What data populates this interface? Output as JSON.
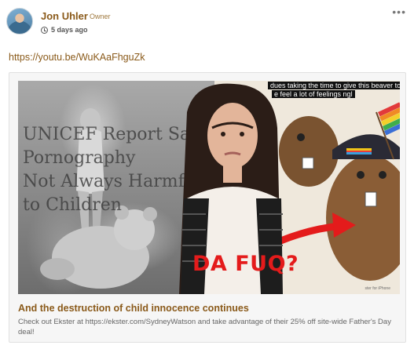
{
  "post": {
    "author": "Jon Uhler",
    "role": "Owner",
    "time": "5 days ago",
    "link_text": "https://youtu.be/WuKAaFhguZk",
    "more_label": "•••"
  },
  "preview": {
    "thumbnail": {
      "overlay_title_lines": [
        "UNICEF Report Says",
        "Pornography",
        "Not Always Harmful",
        "to Children"
      ],
      "caption_top_line1": "dues taking the time to give this beaver top",
      "caption_top_line2": "e feel a lot of feelings ngl",
      "big_text": "DA FUQ?",
      "credit": "ster for iPhone"
    },
    "title": "And the destruction of child innocence continues",
    "description": "Check out Ekster at https://ekster.com/SydneyWatson and take advantage of their 25% off site-wide Father's Day deal!"
  },
  "icons": [
    "avatar",
    "clock-icon",
    "more-icon"
  ],
  "colors": {
    "accent": "#8a5a1a",
    "red_text": "#e41b1b"
  }
}
